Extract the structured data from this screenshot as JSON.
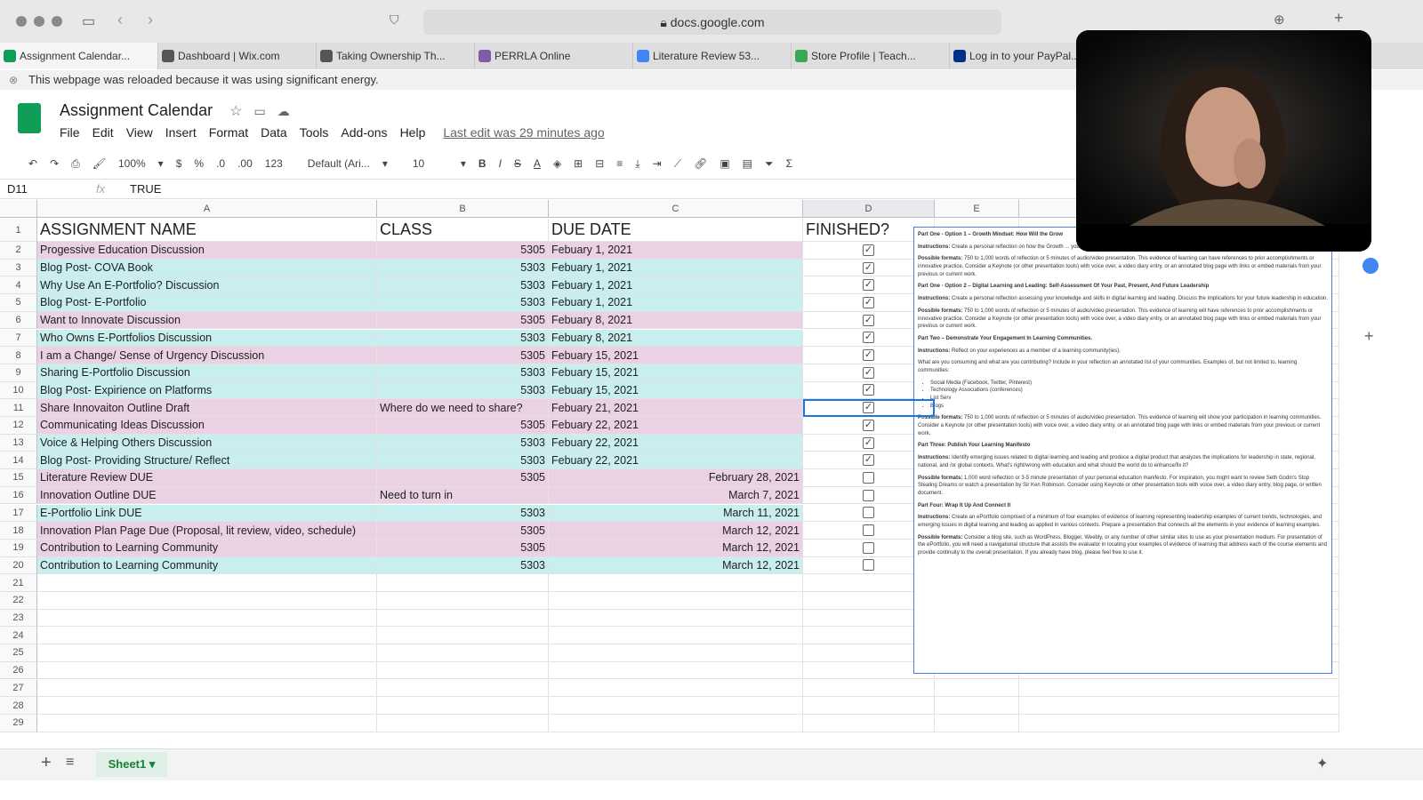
{
  "browser": {
    "url": "docs.google.com",
    "tabs": [
      {
        "label": "Assignment Calendar...",
        "icon": "sheets-icon",
        "color": "#0f9d58"
      },
      {
        "label": "Dashboard | Wix.com",
        "icon": "wix-icon",
        "color": "#555555"
      },
      {
        "label": "Taking Ownership Th...",
        "icon": "wix-icon",
        "color": "#555555"
      },
      {
        "label": "PERRLA Online",
        "icon": "perrla-icon",
        "color": "#7b5ea7"
      },
      {
        "label": "Literature Review 53...",
        "icon": "docs-icon",
        "color": "#4285f4"
      },
      {
        "label": "Store Profile | Teach...",
        "icon": "tpt-icon",
        "color": "#3aa757"
      },
      {
        "label": "Log in to your PayPal...",
        "icon": "paypal-icon",
        "color": "#003087"
      }
    ],
    "info_bar": "This webpage was reloaded because it was using significant energy."
  },
  "doc": {
    "title": "Assignment Calendar",
    "menu": [
      "File",
      "Edit",
      "View",
      "Insert",
      "Format",
      "Data",
      "Tools",
      "Add-ons",
      "Help"
    ],
    "last_edit": "Last edit was 29 minutes ago"
  },
  "toolbar": {
    "zoom": "100%",
    "currency": "$",
    "percent": "%",
    "dec_less": ".0",
    "dec_more": ".00",
    "format": "123",
    "font": "Default (Ari...",
    "size": "10",
    "bold": "B",
    "italic": "I",
    "strike": "S",
    "color": "A"
  },
  "formula": {
    "cell": "D11",
    "fx": "fx",
    "value": "TRUE"
  },
  "columns": [
    "A",
    "B",
    "C",
    "D",
    "E",
    "F"
  ],
  "header": {
    "a": "ASSIGNMENT NAME",
    "b": "CLASS",
    "c": "DUE DATE",
    "d": "FINISHED?"
  },
  "rows": [
    {
      "n": "2",
      "a": "Progessive Education Discussion",
      "b": "5305",
      "c": "Febuary 1, 2021",
      "d": true,
      "color": "pink"
    },
    {
      "n": "3",
      "a": "Blog Post- COVA Book",
      "b": "5303",
      "c": "Febuary 1, 2021",
      "d": true,
      "color": "cyan"
    },
    {
      "n": "4",
      "a": "Why Use An E-Portfolio? Discussion",
      "b": "5303",
      "c": "Febuary 1, 2021",
      "d": true,
      "color": "cyan"
    },
    {
      "n": "5",
      "a": "Blog Post- E-Portfolio",
      "b": "5303",
      "c": "Febuary 1, 2021",
      "d": true,
      "color": "cyan"
    },
    {
      "n": "6",
      "a": "Want to Innovate Discussion",
      "b": "5305",
      "c": "Febuary 8, 2021",
      "d": true,
      "color": "pink"
    },
    {
      "n": "7",
      "a": "Who Owns E-Portfolios Discussion",
      "b": "5303",
      "c": "Febuary 8, 2021",
      "d": true,
      "color": "cyan"
    },
    {
      "n": "8",
      "a": "I am a Change/ Sense of Urgency Discussion",
      "b": "5305",
      "c": "Febuary 15, 2021",
      "d": true,
      "color": "pink"
    },
    {
      "n": "9",
      "a": "Sharing E-Portfolio Discussion",
      "b": "5303",
      "c": "Febuary 15, 2021",
      "d": true,
      "color": "cyan"
    },
    {
      "n": "10",
      "a": "Blog Post- Expirience on Platforms",
      "b": "5303",
      "c": "Febuary 15, 2021",
      "d": true,
      "color": "cyan"
    },
    {
      "n": "11",
      "a": "Share Innovaiton Outline Draft",
      "b": "Where do we need to share?",
      "c": "Febuary 21, 2021",
      "d": true,
      "color": "pink"
    },
    {
      "n": "12",
      "a": "Communicating Ideas Discussion",
      "b": "5305",
      "c": "Febuary 22, 2021",
      "d": true,
      "color": "pink"
    },
    {
      "n": "13",
      "a": "Voice & Helping Others Discussion",
      "b": "5303",
      "c": "Febuary 22, 2021",
      "d": true,
      "color": "cyan"
    },
    {
      "n": "14",
      "a": "Blog Post- Providing Structure/ Reflect",
      "b": "5303",
      "c": "Febuary 22, 2021",
      "d": true,
      "color": "cyan"
    },
    {
      "n": "15",
      "a": "Literature Review DUE",
      "b": "5305",
      "c": "February 28, 2021",
      "d": false,
      "color": "pink"
    },
    {
      "n": "16",
      "a": "Innovation Outline DUE",
      "b": "Need to turn in",
      "c": "March 7, 2021",
      "d": false,
      "color": "pink"
    },
    {
      "n": "17",
      "a": "E-Portfolio Link DUE",
      "b": "5303",
      "c": "March 11, 2021",
      "d": false,
      "color": "cyan"
    },
    {
      "n": "18",
      "a": "Innovation Plan Page Due (Proposal, lit review, video, schedule)",
      "b": "5305",
      "c": "March 12, 2021",
      "d": false,
      "color": "pink"
    },
    {
      "n": "19",
      "a": "Contribution to Learning Community",
      "b": "5305",
      "c": "March 12, 2021",
      "d": false,
      "color": "pink"
    },
    {
      "n": "20",
      "a": "Contribution to Learning Community",
      "b": "5303",
      "c": "March 12, 2021",
      "d": false,
      "color": "cyan"
    }
  ],
  "empty_rows": [
    "21",
    "22",
    "23",
    "24",
    "25",
    "26",
    "27",
    "28",
    "29"
  ],
  "image_text": [
    {
      "h": "Part One - Option 1 – Growth Mindset: How Will the Grow"
    },
    {
      "b": "Instructions:",
      "t": " Create a personal reflection on how the Growth ... your future leadership in education."
    },
    {
      "b": "Possible formats:",
      "t": " 750 to 1,000 words of reflection or 5 minutes of audio/video presentation. This evidence of learning can have references to prior accomplishments or innovative practice. Consider a Keynote (or other presentation tools) with voice over, a video diary entry, or an annotated blog page with links or embed materials from your previous or current work."
    },
    {
      "h": "Part One - Option 2 – Digital Learning and Leading: Self-Assessment Of Your Past, Present, And Future Leadership"
    },
    {
      "b": "Instructions:",
      "t": " Create a personal reflection assessing your knowledge and skills in digital learning and leading. Discuss the implications for your future leadership in education."
    },
    {
      "b": "Possible formats:",
      "t": " 750 to 1,000 words of reflection or 5 minutes of audio/video presentation. This evidence of learning will have references to prior accomplishments or innovative practice. Consider a Keynote (or other presentation tools) with voice over, a video diary entry, or an annotated blog page with links or embed materials from your previous or current work."
    },
    {
      "h": "Part Two – Demonstrate Your Engagement In Learning Communities."
    },
    {
      "b": "Instructions:",
      "t": " Reflect on your experiences as a member of a learning community(ies)."
    },
    {
      "t": "What are you consuming and what are you contributing? Include in your reflection an annotated list of your communities. Examples of, but not limited to, learning communities:"
    },
    {
      "list": [
        "Social Media (Facebook, Twitter, Pinterest)",
        "Technology Associations (conferences)",
        "List Serv",
        "Blogs"
      ]
    },
    {
      "b": "Possible formats:",
      "t": " 750 to 1,000 words of reflection or 5 minutes of audio/video presentation. This evidence of learning will show your participation in learning communities. Consider a Keynote (or other presentation tools) with voice over, a video diary entry, or an annotated blog page with links or embed materials from your previous or current work."
    },
    {
      "h": "Part Three: Publish Your Learning Manifesto"
    },
    {
      "b": "Instructions:",
      "t": " Identify emerging issues related to digital learning and leading and produce a digital product that analyzes the implications for leadership in state, regional, national, and /or global contexts. What's right/wrong with education and what should the world do to enhance/fix it?"
    },
    {
      "b": "Possible formats:",
      "t": " 1,000 word reflection or 3-5 minute presentation of your personal education manifesto. For inspiration, you might want to review Seth Godin's Stop Stealing Dreams or watch a presentation by Sir Ken Robinson. Consider using Keynote or other presentation tools with voice over, a video diary entry, blog page, or written document."
    },
    {
      "h": "Part Four: Wrap It Up And Connect It"
    },
    {
      "b": "Instructions:",
      "t": " Create an ePortfolio comprised of a minimum of four examples of evidence of learning representing leadership examples of current trends, technologies, and emerging issues in digital learning and leading as applied in various contexts. Prepare a presentation that connects all the elements in your evidence of learning examples."
    },
    {
      "b": "Possible formats:",
      "t": " Consider a blog site, such as WordPress, Blogger, Weebly, or any number of other similar sites to use as your presentation medium. For presentation of the ePortfolio, you will need a navigational structure that assists the evaluator in locating your examples of evidence of learning that address each of the course elements and provide continuity to the overall presentation. If you already have blog, please feel free to use it."
    }
  ],
  "sheet": {
    "tab": "Sheet1"
  },
  "colors": {
    "pink": "#ead1e4",
    "cyan": "#c8eef0",
    "accent": "#1a73e8"
  }
}
